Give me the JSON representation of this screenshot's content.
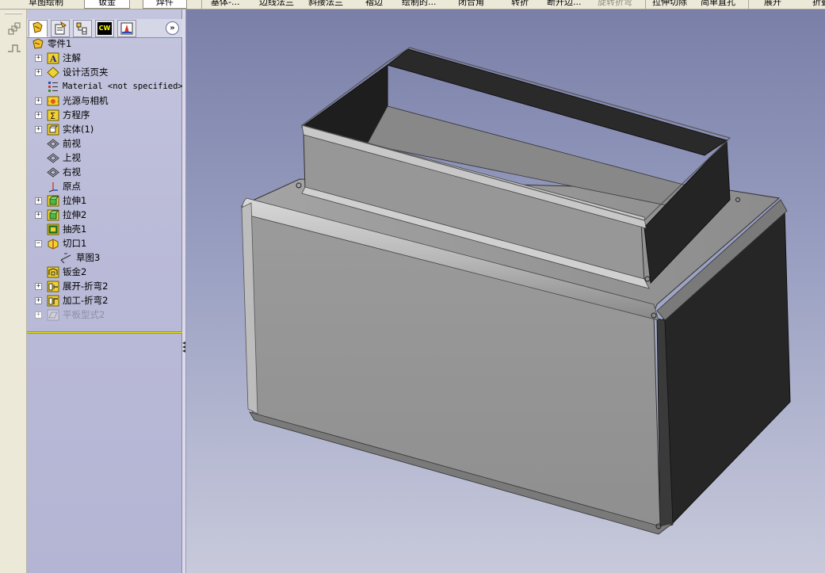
{
  "command_tabs": {
    "sketch": "草图绘制",
    "sheetmetal": "钣金",
    "weldments": "焊件"
  },
  "toolbar": {
    "base_flange": "基体-...",
    "edge_flange": "边线法兰",
    "miter_flange": "斜接法兰",
    "hem": "褶边",
    "sketched_bend": "绘制的...",
    "closed_corner": "闭合角",
    "jog": "转折",
    "break_corner": "断开边...",
    "rip": "旋转折弯",
    "extruded_cut": "拉伸切除",
    "simple_hole": "简单直孔",
    "unfold": "展开",
    "fold": "折叠"
  },
  "feature_tree": {
    "root": "零件1",
    "items": [
      {
        "label": "注解",
        "icon": "annotations-icon",
        "expandable": true
      },
      {
        "label": "设计活页夹",
        "icon": "design-binder-icon",
        "expandable": true
      },
      {
        "label": "Material <not specified>",
        "icon": "material-icon",
        "expandable": false
      },
      {
        "label": "光源与相机",
        "icon": "lights-cameras-icon",
        "expandable": true
      },
      {
        "label": "方程序",
        "icon": "equations-icon",
        "expandable": true
      },
      {
        "label": "实体(1)",
        "icon": "solid-bodies-icon",
        "expandable": true
      },
      {
        "label": "前视",
        "icon": "plane-icon",
        "expandable": false
      },
      {
        "label": "上视",
        "icon": "plane-icon",
        "expandable": false
      },
      {
        "label": "右视",
        "icon": "plane-icon",
        "expandable": false
      },
      {
        "label": "原点",
        "icon": "origin-icon",
        "expandable": false
      },
      {
        "label": "拉伸1",
        "icon": "extrude-icon",
        "expandable": true
      },
      {
        "label": "拉伸2",
        "icon": "extrude-icon",
        "expandable": true
      },
      {
        "label": "抽壳1",
        "icon": "shell-icon",
        "expandable": false
      },
      {
        "label": "切口1",
        "icon": "rip-icon",
        "expandable": true,
        "expanded": true
      },
      {
        "label": "草图3",
        "icon": "sketch-icon",
        "expandable": false,
        "child": true
      },
      {
        "label": "钣金2",
        "icon": "sheetmetal-icon",
        "expandable": false
      },
      {
        "label": "展开-折弯2",
        "icon": "flatten-bends-icon",
        "expandable": true
      },
      {
        "label": "加工-折弯2",
        "icon": "process-bends-icon",
        "expandable": true
      },
      {
        "label": "平板型式2",
        "icon": "flat-pattern-icon",
        "expandable": true,
        "suppressed": true
      }
    ]
  },
  "panel_tabs": {
    "cw_label": "CW",
    "expand_label": "»"
  },
  "colors": {
    "panel_bg": "#babbd8",
    "viewport_top": "#7a7fa8",
    "viewport_bottom": "#c8cadb",
    "part_face": "#9a9a9a",
    "part_dark": "#262626",
    "rollback_bar": "#e8e22a"
  }
}
